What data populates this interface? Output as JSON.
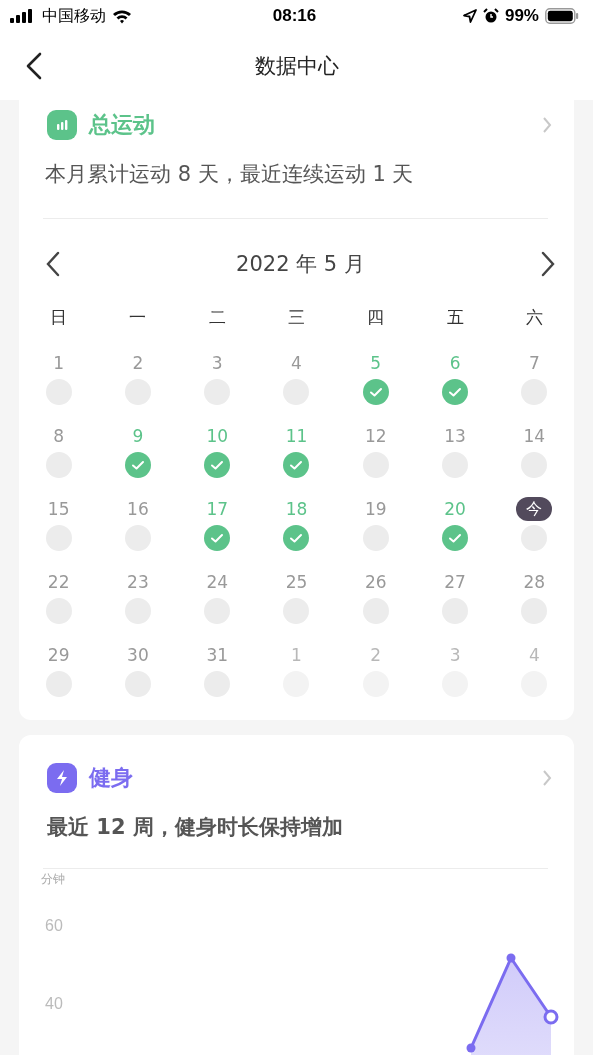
{
  "status_bar": {
    "carrier": "中国移动",
    "time": "08:16",
    "battery": "99%"
  },
  "nav": {
    "title": "数据中心"
  },
  "sport_card": {
    "title": "总运动",
    "summary": "本月累计运动 8 天，最近连续运动 1 天",
    "month": "2022 年 5 月",
    "weekdays": [
      "日",
      "一",
      "二",
      "三",
      "四",
      "五",
      "六"
    ],
    "days": [
      {
        "label": "1",
        "kind": "current",
        "done": false,
        "today": false
      },
      {
        "label": "2",
        "kind": "current",
        "done": false,
        "today": false
      },
      {
        "label": "3",
        "kind": "current",
        "done": false,
        "today": false
      },
      {
        "label": "4",
        "kind": "current",
        "done": false,
        "today": false
      },
      {
        "label": "5",
        "kind": "current",
        "done": true,
        "today": false
      },
      {
        "label": "6",
        "kind": "current",
        "done": true,
        "today": false
      },
      {
        "label": "7",
        "kind": "current",
        "done": false,
        "today": false
      },
      {
        "label": "8",
        "kind": "current",
        "done": false,
        "today": false
      },
      {
        "label": "9",
        "kind": "current",
        "done": true,
        "today": false
      },
      {
        "label": "10",
        "kind": "current",
        "done": true,
        "today": false
      },
      {
        "label": "11",
        "kind": "current",
        "done": true,
        "today": false
      },
      {
        "label": "12",
        "kind": "current",
        "done": false,
        "today": false
      },
      {
        "label": "13",
        "kind": "current",
        "done": false,
        "today": false
      },
      {
        "label": "14",
        "kind": "current",
        "done": false,
        "today": false
      },
      {
        "label": "15",
        "kind": "current",
        "done": false,
        "today": false
      },
      {
        "label": "16",
        "kind": "current",
        "done": false,
        "today": false
      },
      {
        "label": "17",
        "kind": "current",
        "done": true,
        "today": false
      },
      {
        "label": "18",
        "kind": "current",
        "done": true,
        "today": false
      },
      {
        "label": "19",
        "kind": "current",
        "done": false,
        "today": false
      },
      {
        "label": "20",
        "kind": "current",
        "done": true,
        "today": false
      },
      {
        "label": "今",
        "kind": "current",
        "done": false,
        "today": true
      },
      {
        "label": "22",
        "kind": "current",
        "done": false,
        "today": false
      },
      {
        "label": "23",
        "kind": "current",
        "done": false,
        "today": false
      },
      {
        "label": "24",
        "kind": "current",
        "done": false,
        "today": false
      },
      {
        "label": "25",
        "kind": "current",
        "done": false,
        "today": false
      },
      {
        "label": "26",
        "kind": "current",
        "done": false,
        "today": false
      },
      {
        "label": "27",
        "kind": "current",
        "done": false,
        "today": false
      },
      {
        "label": "28",
        "kind": "current",
        "done": false,
        "today": false
      },
      {
        "label": "29",
        "kind": "current",
        "done": false,
        "today": false
      },
      {
        "label": "30",
        "kind": "current",
        "done": false,
        "today": false
      },
      {
        "label": "31",
        "kind": "current",
        "done": false,
        "today": false
      },
      {
        "label": "1",
        "kind": "next",
        "done": false,
        "today": false
      },
      {
        "label": "2",
        "kind": "next",
        "done": false,
        "today": false
      },
      {
        "label": "3",
        "kind": "next",
        "done": false,
        "today": false
      },
      {
        "label": "4",
        "kind": "next",
        "done": false,
        "today": false
      }
    ]
  },
  "fitness_card": {
    "title": "健身",
    "summary": "最近 12 周，健身时长保持增加",
    "chart": {
      "unit": "分钟",
      "y_labels": [
        "60",
        "40"
      ]
    }
  }
}
